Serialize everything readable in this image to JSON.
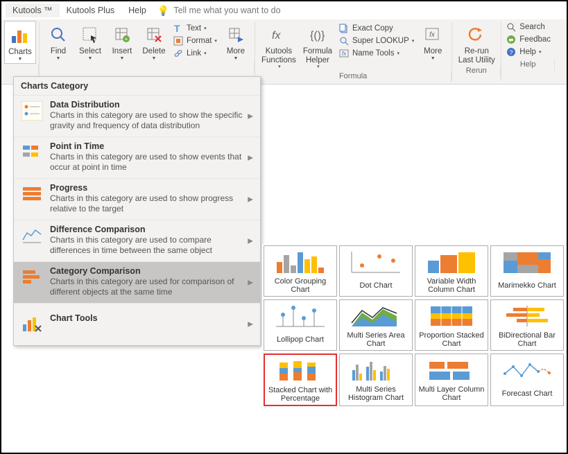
{
  "menubar": {
    "items": [
      "Kutools ™",
      "Kutools Plus",
      "Help"
    ],
    "tellme": "Tell me what you want to do"
  },
  "ribbon": {
    "charts": "Charts",
    "find": "Find",
    "select": "Select",
    "insert": "Insert",
    "delete": "Delete",
    "text": "Text",
    "format": "Format",
    "link": "Link",
    "more1": "More",
    "kt_functions": "Kutools\nFunctions",
    "formula_helper": "Formula\nHelper",
    "exact_copy": "Exact Copy",
    "super_lookup": "Super LOOKUP",
    "name_tools": "Name Tools",
    "more2": "More",
    "rerun": "Re-run\nLast Utility",
    "search": "Search",
    "feedback": "Feedbac",
    "help": "Help",
    "group_formula": "Formula",
    "group_rerun": "Rerun",
    "group_help": "Help"
  },
  "panel": {
    "header": "Charts Category",
    "items": [
      {
        "title": "Data Distribution",
        "desc": "Charts in this category are used to show the specific gravity and frequency of data distribution"
      },
      {
        "title": "Point in Time",
        "desc": "Charts in this category are used to show events that occur at point in time"
      },
      {
        "title": "Progress",
        "desc": "Charts in this category are used to show progress relative to the target"
      },
      {
        "title": "Difference Comparison",
        "desc": "Charts in this category are used to compare differences in time between the same object"
      },
      {
        "title": "Category Comparison",
        "desc": "Charts in this category are used for comparison of different objects at the same time"
      },
      {
        "title": "Chart Tools",
        "desc": ""
      }
    ]
  },
  "gallery": [
    "Color Grouping Chart",
    "Dot Chart",
    "Variable Width Column Chart",
    "Marimekko Chart",
    "Lollipop Chart",
    "Multi Series Area Chart",
    "Proportion Stacked Chart",
    "BiDirectional Bar Chart",
    "Stacked Chart with Percentage",
    "Multi Series Histogram Chart",
    "Multi Layer Column Chart",
    "Forecast Chart"
  ]
}
